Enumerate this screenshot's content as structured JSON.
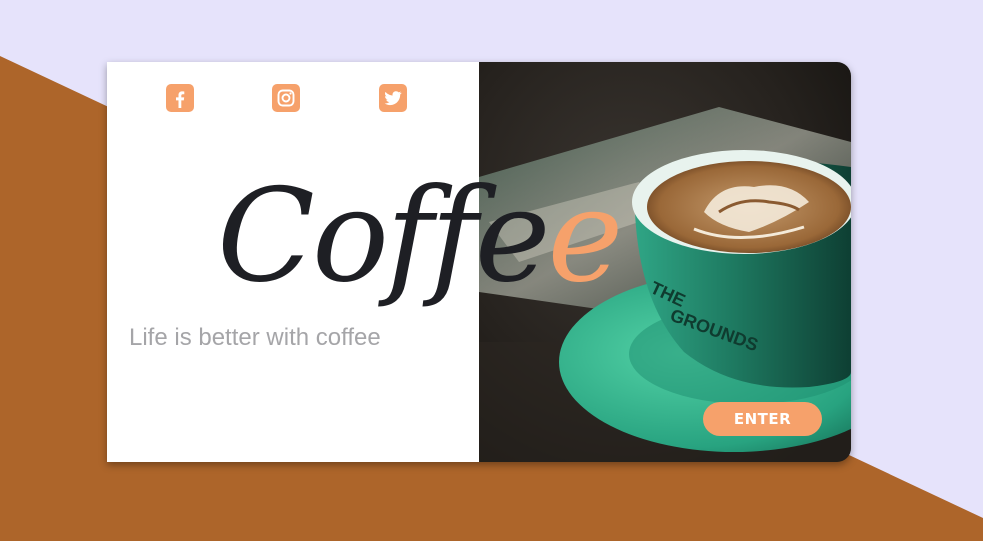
{
  "colors": {
    "background_light": "#e6e3fb",
    "background_brown": "#ad652a",
    "accent": "#f6a16b",
    "title_dark": "#1e1f24",
    "tagline_gray": "#a5a5a8"
  },
  "social": [
    {
      "name": "facebook",
      "icon": "facebook-icon"
    },
    {
      "name": "instagram",
      "icon": "instagram-icon"
    },
    {
      "name": "twitter",
      "icon": "twitter-icon"
    }
  ],
  "hero": {
    "title_main": "Coffe",
    "title_accent": "e",
    "tagline": "Life is better with coffee"
  },
  "photo": {
    "icon": "coffee-cup-photo"
  },
  "cta": {
    "label": "ENTER"
  }
}
